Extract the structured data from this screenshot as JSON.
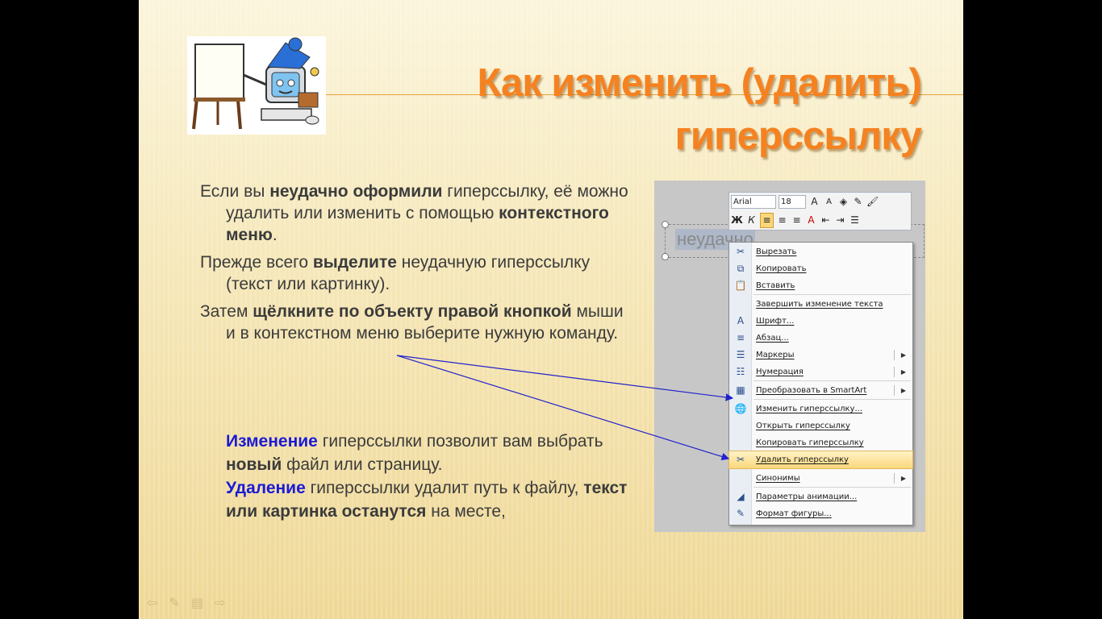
{
  "slide": {
    "title_line1": "Как изменить (удалить)",
    "title_line2": "гиперссылку",
    "p1": {
      "a": "Если вы ",
      "b": "неудачно оформили",
      "c": " гиперссылку, её можно удалить или изменить с помощью ",
      "d": "контекстного меню",
      "e": "."
    },
    "p2": {
      "a": "Прежде всего ",
      "b": "выделите",
      "c": " неудачную гиперссылку (текст или картинку)."
    },
    "p3": {
      "a": "Затем ",
      "b": "щёлкните по объекту правой кнопкой",
      "c": " мыши и в контекстном меню выберите нужную команду."
    },
    "note": {
      "change_word": "Изменение",
      "change_rest": " гиперссылки позволит вам выбрать ",
      "change_bold": "новый",
      "change_end": " файл или страницу.",
      "delete_word": "Удаление",
      "delete_rest": " гиперссылки удалит путь к файлу, ",
      "delete_bold": "текст или картинка останутся",
      "delete_end": " на месте,"
    }
  },
  "screenshot": {
    "font_name": "Arial",
    "font_size": "18",
    "selected_text": "неудачно",
    "toolbar_icons": [
      "grow-font",
      "shrink-font",
      "fill-color",
      "line-color",
      "format-painter",
      "bold",
      "italic",
      "align-left",
      "align-center",
      "align-right",
      "font-color",
      "decrease-indent",
      "increase-indent",
      "bullets"
    ],
    "menu": [
      {
        "label": "Вырезать",
        "icon": "✂",
        "submenu": false,
        "highlighted": false
      },
      {
        "label": "Копировать",
        "icon": "⧉",
        "submenu": false,
        "highlighted": false
      },
      {
        "label": "Вставить",
        "icon": "📋",
        "submenu": false,
        "highlighted": false
      },
      {
        "label": "Завершить изменение текста",
        "icon": "",
        "submenu": false,
        "highlighted": false
      },
      {
        "label": "Шрифт...",
        "icon": "A",
        "submenu": false,
        "highlighted": false
      },
      {
        "label": "Абзац...",
        "icon": "≡",
        "submenu": false,
        "highlighted": false
      },
      {
        "label": "Маркеры",
        "icon": "☰",
        "submenu": true,
        "highlighted": false
      },
      {
        "label": "Нумерация",
        "icon": "☷",
        "submenu": true,
        "highlighted": false
      },
      {
        "label": "Преобразовать в SmartArt",
        "icon": "▦",
        "submenu": true,
        "highlighted": false
      },
      {
        "label": "Изменить гиперссылку...",
        "icon": "🌐",
        "submenu": false,
        "highlighted": false
      },
      {
        "label": "Открыть гиперссылку",
        "icon": "",
        "submenu": false,
        "highlighted": false
      },
      {
        "label": "Копировать гиперссылку",
        "icon": "",
        "submenu": false,
        "highlighted": false
      },
      {
        "label": "Удалить гиперссылку",
        "icon": "✂",
        "submenu": false,
        "highlighted": true
      },
      {
        "label": "Синонимы",
        "icon": "",
        "submenu": true,
        "highlighted": false
      },
      {
        "label": "Параметры анимации...",
        "icon": "◢",
        "submenu": false,
        "highlighted": false
      },
      {
        "label": "Формат фигуры...",
        "icon": "✎",
        "submenu": false,
        "highlighted": false
      }
    ]
  },
  "colors": {
    "title": "#f58220",
    "accent_blue": "#1a1ad6",
    "arrow": "#2222cc",
    "menu_highlight": "#fbd77c"
  }
}
